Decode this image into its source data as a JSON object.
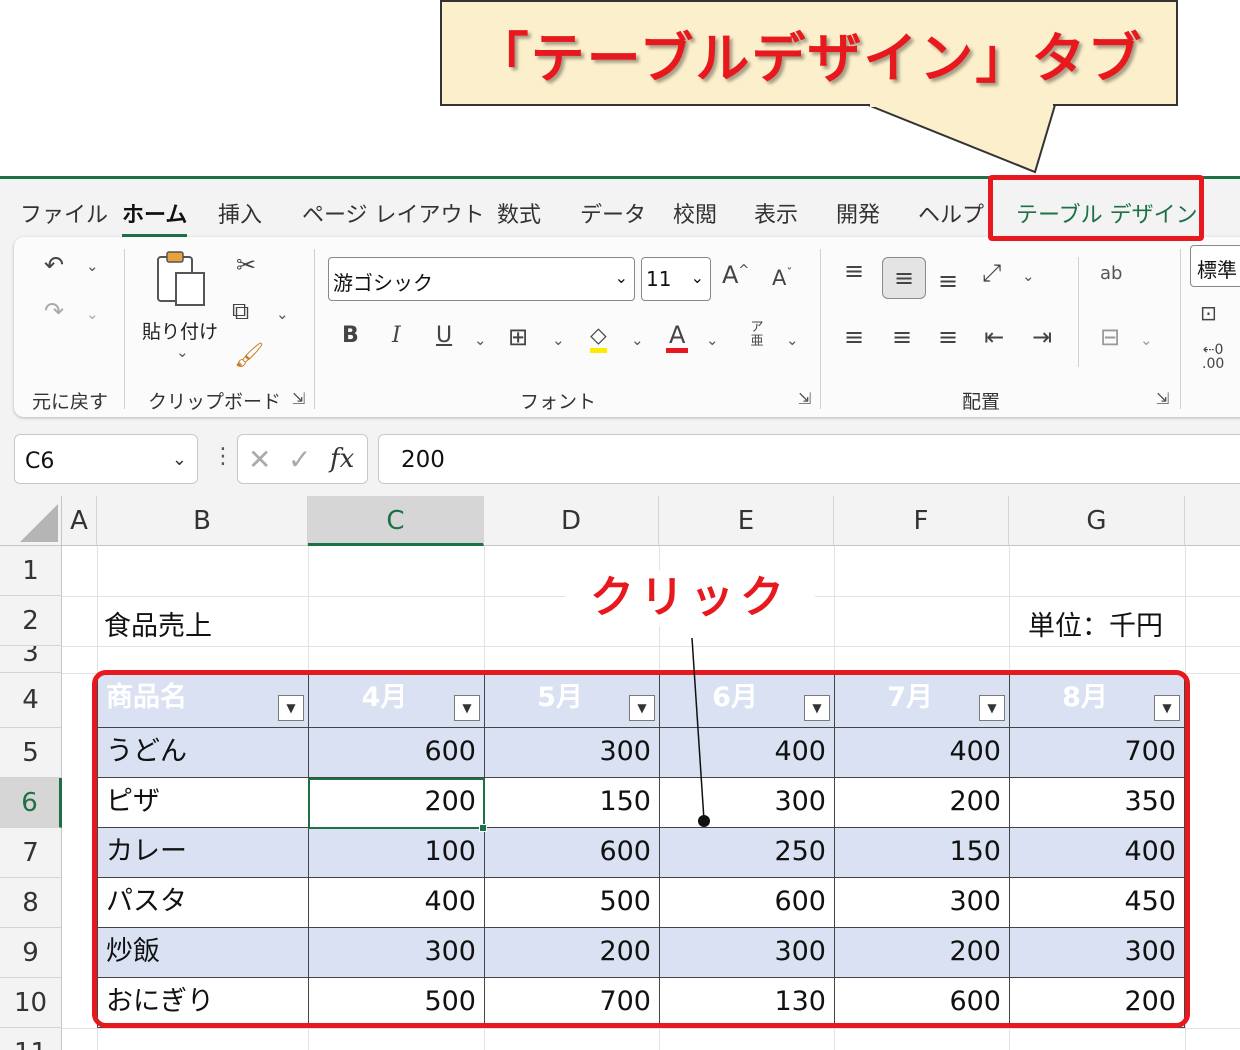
{
  "callout": {
    "text": "「テーブルデザイン」タブ"
  },
  "tabs": [
    {
      "label": "ファイル"
    },
    {
      "label": "ホーム"
    },
    {
      "label": "挿入"
    },
    {
      "label": "ページ レイアウト"
    },
    {
      "label": "数式"
    },
    {
      "label": "データ"
    },
    {
      "label": "校閲"
    },
    {
      "label": "表示"
    },
    {
      "label": "開発"
    },
    {
      "label": "ヘルプ"
    },
    {
      "label": "テーブル デザイン"
    }
  ],
  "ribbon": {
    "undo_group": "元に戻す",
    "paste_label": "貼り付け",
    "clipboard_group": "クリップボード",
    "font_name": "游ゴシック",
    "font_size": "11",
    "bold": "B",
    "italic": "I",
    "underline": "U",
    "grow_font": "A",
    "shrink_font": "A",
    "phonetic": "ア亜",
    "font_group": "フォント",
    "alignment_group": "配置",
    "number_format": "標準",
    "wrap_text_icon_text": "ab",
    "decimal_text": ".00"
  },
  "formula_bar": {
    "name_box": "C6",
    "fx": "fx",
    "formula": "200"
  },
  "columns": [
    "A",
    "B",
    "C",
    "D",
    "E",
    "F",
    "G"
  ],
  "rows": [
    "1",
    "2",
    "3",
    "4",
    "5",
    "6",
    "7",
    "8",
    "9",
    "10",
    "11"
  ],
  "sheet": {
    "title": "食品売上",
    "unit": "単位：千円"
  },
  "table": {
    "headers": [
      "商品名",
      "4月",
      "5月",
      "6月",
      "7月",
      "8月"
    ],
    "rows": [
      [
        "うどん",
        "600",
        "300",
        "400",
        "400",
        "700"
      ],
      [
        "ピザ",
        "200",
        "150",
        "300",
        "200",
        "350"
      ],
      [
        "カレー",
        "100",
        "600",
        "250",
        "150",
        "400"
      ],
      [
        "パスタ",
        "400",
        "500",
        "600",
        "300",
        "450"
      ],
      [
        "炒飯",
        "300",
        "200",
        "300",
        "200",
        "300"
      ],
      [
        "おにぎり",
        "500",
        "700",
        "130",
        "600",
        "200"
      ]
    ]
  },
  "annotation": {
    "click": "クリック"
  },
  "colors": {
    "accent_green": "#1e7145",
    "highlight_red": "#e8191e",
    "table_band": "#d9e1f2",
    "callout_bg": "#fcf0cc"
  }
}
